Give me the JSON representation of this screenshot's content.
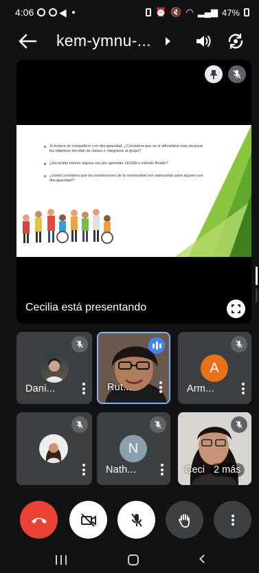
{
  "status_bar": {
    "time": "4:06",
    "battery": "47%"
  },
  "header": {
    "meeting_code": "kem-ymnu-..."
  },
  "presentation": {
    "presenter_label": "Cecilia está presentando",
    "slide_lines": [
      "Si tuviera un compañero con discapacidad, ¿Considera que se le dificultaría más alcanzar los objetivos del plan de clases e integrarse al grupo?",
      "¿Ha tenido interés alguna vez por aprender LESSA o método Braille?",
      "¿Usted considera que las instalaciones de la universidad son adecuadas para alguien con discapacidad?"
    ]
  },
  "participants": [
    {
      "name": "Dani...",
      "kind": "photo",
      "muted": true
    },
    {
      "name": "Rut...",
      "kind": "video",
      "muted": false,
      "speaking": true
    },
    {
      "name": "Arm...",
      "kind": "letter",
      "letter": "A",
      "color": "#e8711a",
      "muted": true
    },
    {
      "name": "",
      "kind": "photo",
      "muted": true
    },
    {
      "name": "Nath...",
      "kind": "letter",
      "letter": "N",
      "color": "#8ba0ad",
      "muted": true
    },
    {
      "name": "Ceci",
      "kind": "video",
      "muted": true
    }
  ],
  "overflow": {
    "label": "2 más"
  },
  "colors": {
    "end_call": "#ea4335",
    "tile_bg": "#3c4043",
    "active_border": "#8ab4f8"
  },
  "controls": [
    "end-call",
    "camera-off",
    "mic-off",
    "raise-hand",
    "more-options"
  ]
}
